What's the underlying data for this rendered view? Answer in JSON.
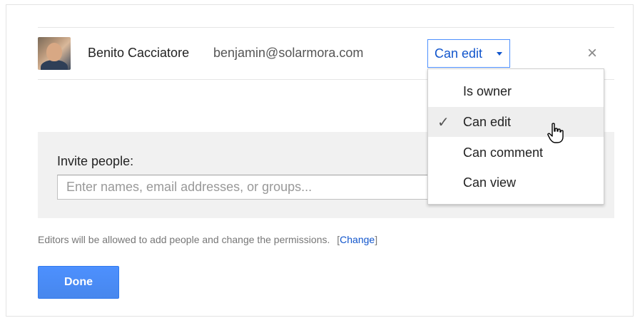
{
  "collaborator": {
    "name": "Benito Cacciatore",
    "email": "benjamin@solarmora.com",
    "permission": "Can edit"
  },
  "permission_menu": {
    "items": [
      {
        "label": "Is owner",
        "checked": false
      },
      {
        "label": "Can edit",
        "checked": true
      },
      {
        "label": "Can comment",
        "checked": false
      },
      {
        "label": "Can view",
        "checked": false
      }
    ],
    "check_glyph": "✓"
  },
  "invite": {
    "label": "Invite people:",
    "placeholder": "Enter names, email addresses, or groups..."
  },
  "note": {
    "text": "Editors will be allowed to add people and change the permissions.",
    "open_bracket": "[",
    "link": "Change",
    "close_bracket": "]"
  },
  "actions": {
    "done_label": "Done",
    "close_glyph": "×"
  },
  "colors": {
    "accent_blue": "#4d90fe",
    "link_blue": "#1155cc",
    "panel_gray": "#f1f1f1"
  },
  "icons": {
    "close": "close-icon",
    "caret": "chevron-down-icon",
    "check": "check-icon",
    "cursor": "hand-cursor-icon"
  }
}
